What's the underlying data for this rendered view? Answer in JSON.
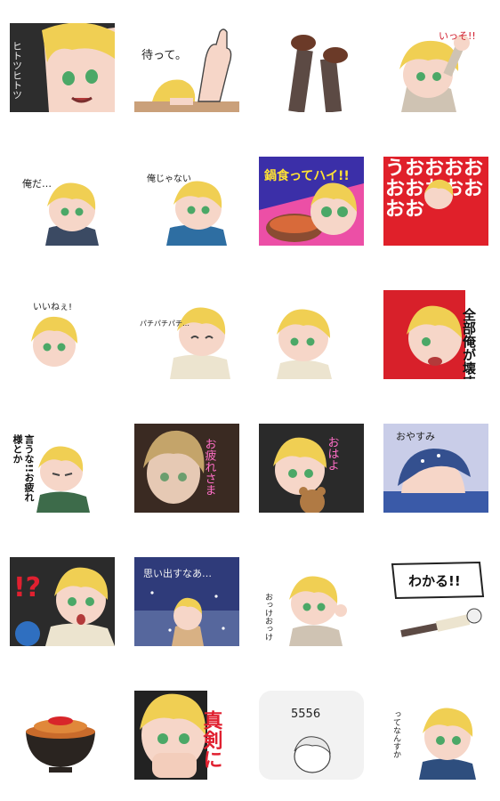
{
  "stickers": [
    {
      "id": "s01",
      "caption": "ヒトツヒトツ",
      "bg": "#2d2d2d"
    },
    {
      "id": "s02",
      "caption": "待って。",
      "bg": "#ffffff"
    },
    {
      "id": "s03",
      "caption": "",
      "bg": "#ffffff"
    },
    {
      "id": "s04",
      "caption": "いっそ!!",
      "bg": "#ffffff"
    },
    {
      "id": "s05",
      "caption": "俺だ…",
      "bg": "#ffffff"
    },
    {
      "id": "s06",
      "caption": "俺じゃない",
      "bg": "#ffffff"
    },
    {
      "id": "s07",
      "caption": "鍋食ってハイ!!",
      "bg": "#3b2fa8"
    },
    {
      "id": "s08",
      "caption": "うおおおおおおおおおおお",
      "bg": "#e0202a"
    },
    {
      "id": "s09",
      "caption": "いいねぇ!",
      "bg": "#ffffff"
    },
    {
      "id": "s10",
      "caption": "パチパチパチ…",
      "bg": "#ffffff"
    },
    {
      "id": "s11",
      "caption": "",
      "bg": "#ffffff"
    },
    {
      "id": "s12",
      "caption": "全部俺が壊す",
      "bg": "#d8202a"
    },
    {
      "id": "s13",
      "caption": "言うな!!お疲れ様とか",
      "bg": "#ffffff"
    },
    {
      "id": "s14",
      "caption": "お疲れさま",
      "bg": "#3a2a22"
    },
    {
      "id": "s15",
      "caption": "おはよ",
      "bg": "#2a2a2a"
    },
    {
      "id": "s16",
      "caption": "おやすみ",
      "bg": "#c9cde8"
    },
    {
      "id": "s17",
      "caption": "!?",
      "bg": "#2b2b2b"
    },
    {
      "id": "s18",
      "caption": "思い出すなあ…",
      "bg": "#2f3b7a"
    },
    {
      "id": "s19",
      "caption": "おっけおっけ",
      "bg": "#ffffff"
    },
    {
      "id": "s20",
      "caption": "わかる!!",
      "bg": "#ffffff"
    },
    {
      "id": "s21",
      "caption": "",
      "bg": "#ffffff"
    },
    {
      "id": "s22",
      "caption": "真剣に",
      "bg": "#222222"
    },
    {
      "id": "s23",
      "caption": "5556",
      "bg": "#f2f2f2"
    },
    {
      "id": "s24",
      "caption": "ってなんすか",
      "bg": "#ffffff"
    }
  ]
}
